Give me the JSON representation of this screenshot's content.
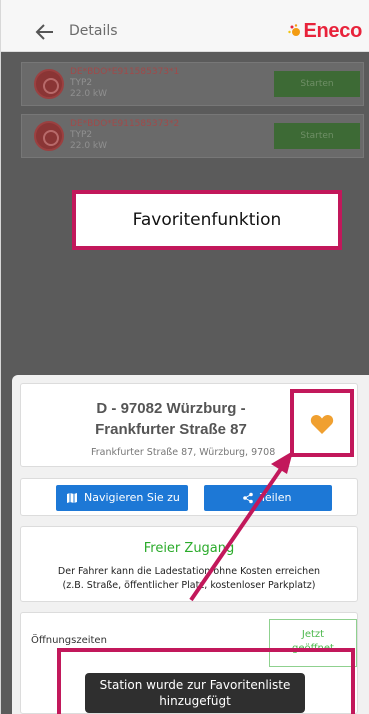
{
  "header": {
    "title": "Details",
    "back_icon": "arrow-left-icon",
    "logo_text": "Eneco",
    "logo_color": "#e8233b"
  },
  "stations": [
    {
      "id": "DE*BDO*E911585373*1",
      "type": "TYP2",
      "power": "22.0 kW",
      "button": "Starten"
    },
    {
      "id": "DE*BDO*E911585373*2",
      "type": "TYP2",
      "power": "22.0 kW",
      "button": "Starten"
    }
  ],
  "callout": {
    "text": "Favoritenfunktion"
  },
  "details": {
    "title_line1": "D - 97082 Würzburg -",
    "title_line2": "Frankfurter Straße 87",
    "subtitle": "Frankfurter Straße 87, Würzburg, 9708",
    "favorite_icon": "heart-icon",
    "favorite_color": "#f0a030"
  },
  "actions": {
    "navigate_label": "Navigieren Sie zu",
    "share_label": "Teilen",
    "button_color": "#1d78d6"
  },
  "access": {
    "title": "Freier Zugang",
    "desc_line1": "Der Fahrer kann die Ladestation ohne Kosten erreichen",
    "desc_line2": "(z.B. Straße, öffentlicher Platz, kostenloser Parkplatz)",
    "title_color": "#2bab2b"
  },
  "hours": {
    "label": "Öffnungszeiten",
    "badge_line1": "Jetzt",
    "badge_line2": "geöffnet"
  },
  "toast": {
    "line1": "Station wurde zur Favoritenliste",
    "line2": "hinzugefügt"
  },
  "highlight_color": "#c2185b"
}
